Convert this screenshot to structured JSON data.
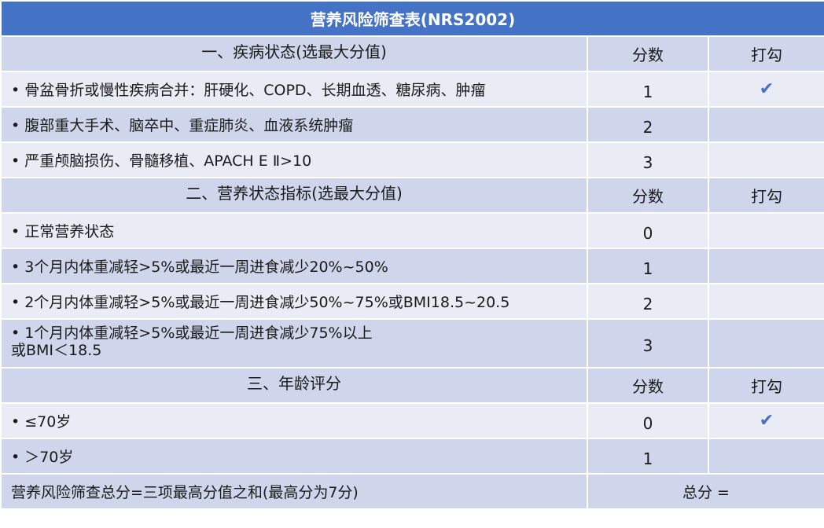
{
  "title": "营养风险筛查表(NRS2002)",
  "score_label": "分数",
  "check_label": "打勾",
  "check_symbol": "✔",
  "bullet": "•",
  "sections": [
    {
      "heading": "一、疾病状态(选最大分值)",
      "items": [
        {
          "text": "骨盆骨折或慢性疾病合并：肝硬化、COPD、长期血透、糖尿病、肿瘤",
          "score": "1",
          "checked": true
        },
        {
          "text": "腹部重大手术、脑卒中、重症肺炎、血液系统肿瘤",
          "score": "2",
          "checked": false
        },
        {
          "text": "严重颅脑损伤、骨髓移植、APACH E Ⅱ>10",
          "score": "3",
          "checked": false
        }
      ]
    },
    {
      "heading": "二、营养状态指标(选最大分值)",
      "items": [
        {
          "text": "正常营养状态",
          "score": "0",
          "checked": false
        },
        {
          "text": "3个月内体重减轻>5%或最近一周进食减少20%~50%",
          "score": "1",
          "checked": false
        },
        {
          "text": "2个月内体重减轻>5%或最近一周进食减少50%~75%或BMI18.5~20.5",
          "score": "2",
          "checked": false
        },
        {
          "text": "1个月内体重减轻>5%或最近一周进食减少75%以上",
          "text2": "或BMI＜18.5",
          "score": "3",
          "checked": false
        }
      ]
    },
    {
      "heading": "三、年龄评分",
      "items": [
        {
          "text": "≤70岁",
          "score": "0",
          "checked": true
        },
        {
          "text": "＞70岁",
          "score": "1",
          "checked": false
        }
      ]
    }
  ],
  "footer": {
    "formula": "营养风险筛查总分=三项最高分值之和(最高分为7分)",
    "total_label": "总分 ="
  }
}
